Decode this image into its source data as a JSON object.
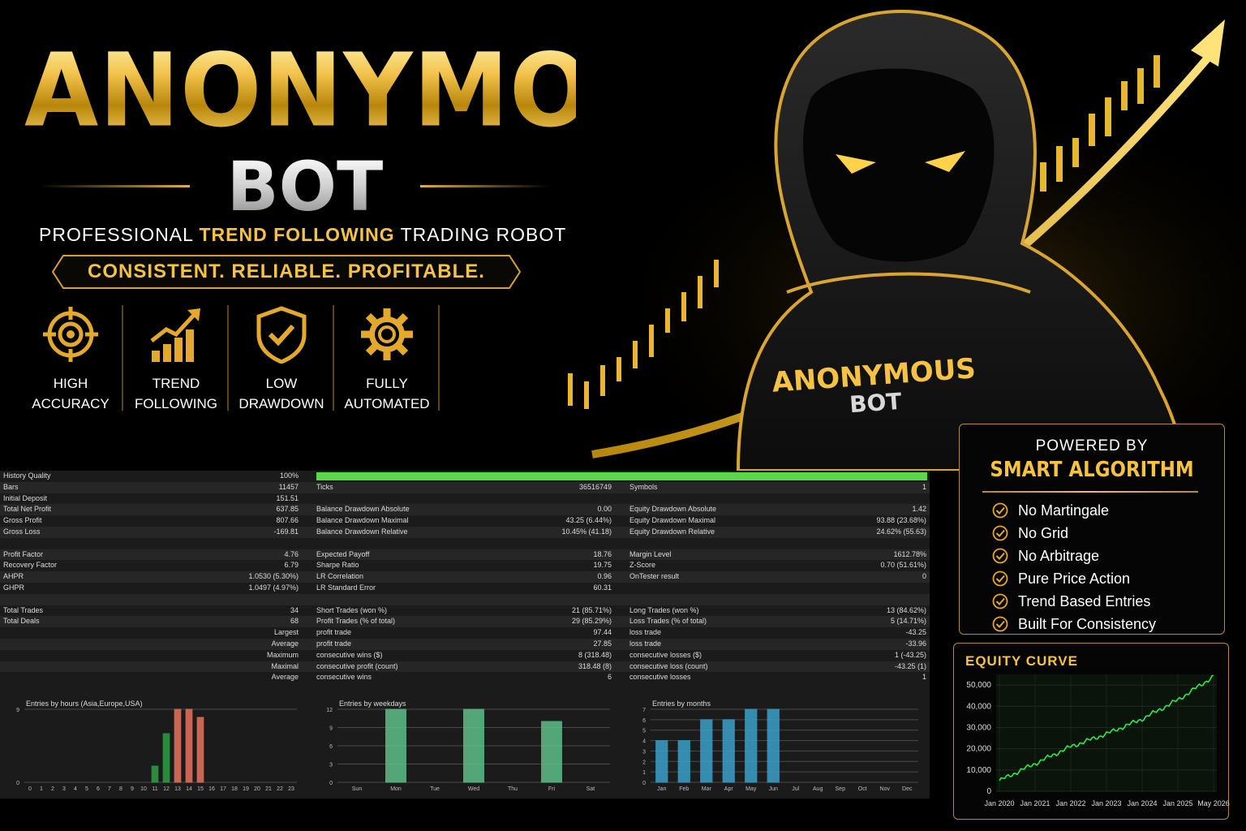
{
  "brand": {
    "title": "ANONYMOUS",
    "subtitle": "BOT",
    "tagline_pre": "PROFESSIONAL",
    "tagline_highlight": "TREND FOLLOWING",
    "tagline_post": "TRADING ROBOT",
    "banner": "CONSISTENT. RELIABLE. PROFITABLE.",
    "accent": "#f5c244"
  },
  "features": [
    {
      "icon": "target-icon",
      "label": "HIGH\nACCURACY"
    },
    {
      "icon": "bar-chart-arrow-icon",
      "label": "TREND\nFOLLOWING"
    },
    {
      "icon": "shield-check-icon",
      "label": "LOW\nDRAWDOWN"
    },
    {
      "icon": "gear-icon",
      "label": "FULLY\nAUTOMATED"
    }
  ],
  "hero": {
    "chest_title": "ANONYMOUS",
    "chest_sub": "BOT"
  },
  "report": {
    "rows": [
      [
        "History Quality",
        "100%",
        "",
        "",
        "",
        ""
      ],
      [
        "Bars",
        "11457",
        "Ticks",
        "36516749",
        "Symbols",
        "1"
      ],
      [
        "Initial Deposit",
        "151.51",
        "",
        "",
        "",
        ""
      ],
      [
        "Total Net Profit",
        "637.85",
        "Balance Drawdown Absolute",
        "0.00",
        "Equity Drawdown Absolute",
        "1.42"
      ],
      [
        "Gross Profit",
        "807.66",
        "Balance Drawdown Maximal",
        "43.25 (6.44%)",
        "Equity Drawdown Maximal",
        "93.88 (23.68%)"
      ],
      [
        "Gross Loss",
        "-169.81",
        "Balance Drawdown Relative",
        "10.45% (41.18)",
        "Equity Drawdown Relative",
        "24.62% (55.63)"
      ],
      [
        "",
        "",
        "",
        "",
        "",
        ""
      ],
      [
        "Profit Factor",
        "4.76",
        "Expected Payoff",
        "18.76",
        "Margin Level",
        "1612.78%"
      ],
      [
        "Recovery Factor",
        "6.79",
        "Sharpe Ratio",
        "19.75",
        "Z-Score",
        "0.70 (51.61%)"
      ],
      [
        "AHPR",
        "1.0530 (5.30%)",
        "LR Correlation",
        "0.96",
        "OnTester result",
        "0"
      ],
      [
        "GHPR",
        "1.0497 (4.97%)",
        "LR Standard Error",
        "60.31",
        "",
        ""
      ],
      [
        "",
        "",
        "",
        "",
        "",
        ""
      ],
      [
        "Total Trades",
        "34",
        "Short Trades (won %)",
        "21 (85.71%)",
        "Long Trades (won %)",
        "13 (84.62%)"
      ],
      [
        "Total Deals",
        "68",
        "Profit Trades (% of total)",
        "29 (85.29%)",
        "Loss Trades (% of total)",
        "5 (14.71%)"
      ],
      [
        "",
        "Largest",
        "profit trade",
        "97.44",
        "loss trade",
        "-43.25"
      ],
      [
        "",
        "Average",
        "profit trade",
        "27.85",
        "loss trade",
        "-33.96"
      ],
      [
        "",
        "Maximum",
        "consecutive wins ($)",
        "8 (318.48)",
        "consecutive losses ($)",
        "1 (-43.25)"
      ],
      [
        "",
        "Maximal",
        "consecutive profit (count)",
        "318.48 (8)",
        "consecutive loss (count)",
        "-43.25 (1)"
      ],
      [
        "",
        "Average",
        "consecutive wins",
        "6",
        "consecutive losses",
        "1"
      ]
    ],
    "history_quality_fill": 1.0,
    "charts": [
      {
        "title": "Entries by hours (Asia,Europe,USA)",
        "ymax": 9,
        "ticks": [
          "0",
          "9"
        ],
        "categories": [
          "0",
          "1",
          "2",
          "3",
          "4",
          "5",
          "6",
          "7",
          "8",
          "9",
          "10",
          "11",
          "12",
          "13",
          "14",
          "15",
          "16",
          "17",
          "18",
          "19",
          "20",
          "21",
          "22",
          "23"
        ],
        "values": [
          0,
          0,
          0,
          0,
          0,
          0,
          0,
          0,
          0,
          0,
          0,
          2,
          6,
          9,
          9,
          8,
          0,
          0,
          0,
          0,
          0,
          0,
          0,
          0
        ],
        "colors": [
          "#2f9e44",
          "#2f9e44",
          "#2f9e44",
          "#2f9e44",
          "#2f9e44",
          "#2f9e44",
          "#2f9e44",
          "#2f9e44",
          "#2f9e44",
          "#2f9e44",
          "#2f9e44",
          "#2f9e44",
          "#2f9e44",
          "#e8735a",
          "#e8735a",
          "#e8735a",
          "#e8735a",
          "#e8735a",
          "#e8735a",
          "#e8735a",
          "#e8735a",
          "#e8735a",
          "#e8735a",
          "#e8735a"
        ]
      },
      {
        "title": "Entries by weekdays",
        "ymax": 12,
        "ticks": [
          "0",
          "3",
          "6",
          "9",
          "12"
        ],
        "categories": [
          "Sun",
          "Mon",
          "Tue",
          "Wed",
          "Thu",
          "Fri",
          "Sat"
        ],
        "values": [
          0,
          12,
          0,
          12,
          0,
          10,
          0
        ],
        "colors": [
          "#5fbf8a"
        ]
      },
      {
        "title": "Entries by months",
        "ymax": 7,
        "ticks": [
          "0",
          "1",
          "2",
          "3",
          "4",
          "5",
          "6",
          "7"
        ],
        "categories": [
          "Jan",
          "Feb",
          "Mar",
          "Apr",
          "May",
          "Jun",
          "Jul",
          "Aug",
          "Sep",
          "Oct",
          "Nov",
          "Dec"
        ],
        "values": [
          4,
          4,
          6,
          6,
          7,
          7,
          0,
          0,
          0,
          0,
          0,
          0
        ],
        "colors": [
          "#3aa0c8"
        ]
      }
    ]
  },
  "panel": {
    "pre": "POWERED BY",
    "headline": "SMART ALGORITHM",
    "items": [
      "No Martingale",
      "No Grid",
      "No Arbitrage",
      "Pure Price Action",
      "Trend Based Entries",
      "Built For Consistency"
    ]
  },
  "chart_data": {
    "type": "line",
    "title": "EQUITY CURVE",
    "ylim": [
      0,
      55000
    ],
    "yticks": [
      "0",
      "10,000",
      "20,000",
      "30,000",
      "40,000",
      "50,000"
    ],
    "x": [
      "Jan 2020",
      "Jan 2021",
      "Jan 2022",
      "Jan 2023",
      "Jan 2024",
      "Jan 2025",
      "May 2026"
    ],
    "series": [
      {
        "values": [
          5000,
          13000,
          21000,
          27000,
          34000,
          43000,
          54000
        ]
      }
    ],
    "color": "#2ee84a"
  }
}
